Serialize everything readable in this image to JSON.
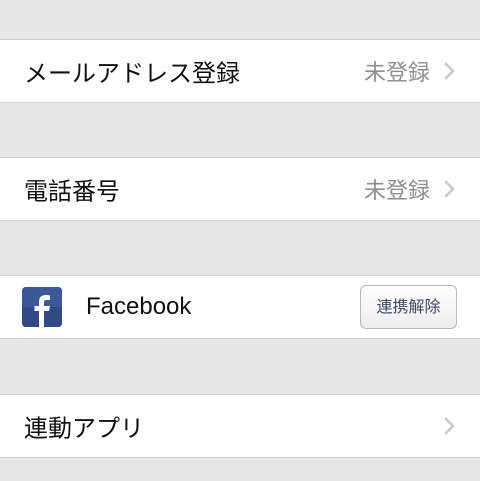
{
  "rows": {
    "email": {
      "label": "メールアドレス登録",
      "value": "未登録",
      "chevron_icon": "chevron-right-icon"
    },
    "phone": {
      "label": "電話番号",
      "value": "未登録",
      "chevron_icon": "chevron-right-icon"
    },
    "facebook": {
      "icon": "facebook-icon",
      "label": "Facebook",
      "button_label": "連携解除"
    },
    "linked_apps": {
      "label": "連動アプリ",
      "chevron_icon": "chevron-right-icon"
    }
  },
  "colors": {
    "background": "#e6e6e9",
    "cell": "#ffffff",
    "secondary_text": "#8e8e93",
    "facebook_blue": "#3b5998"
  }
}
